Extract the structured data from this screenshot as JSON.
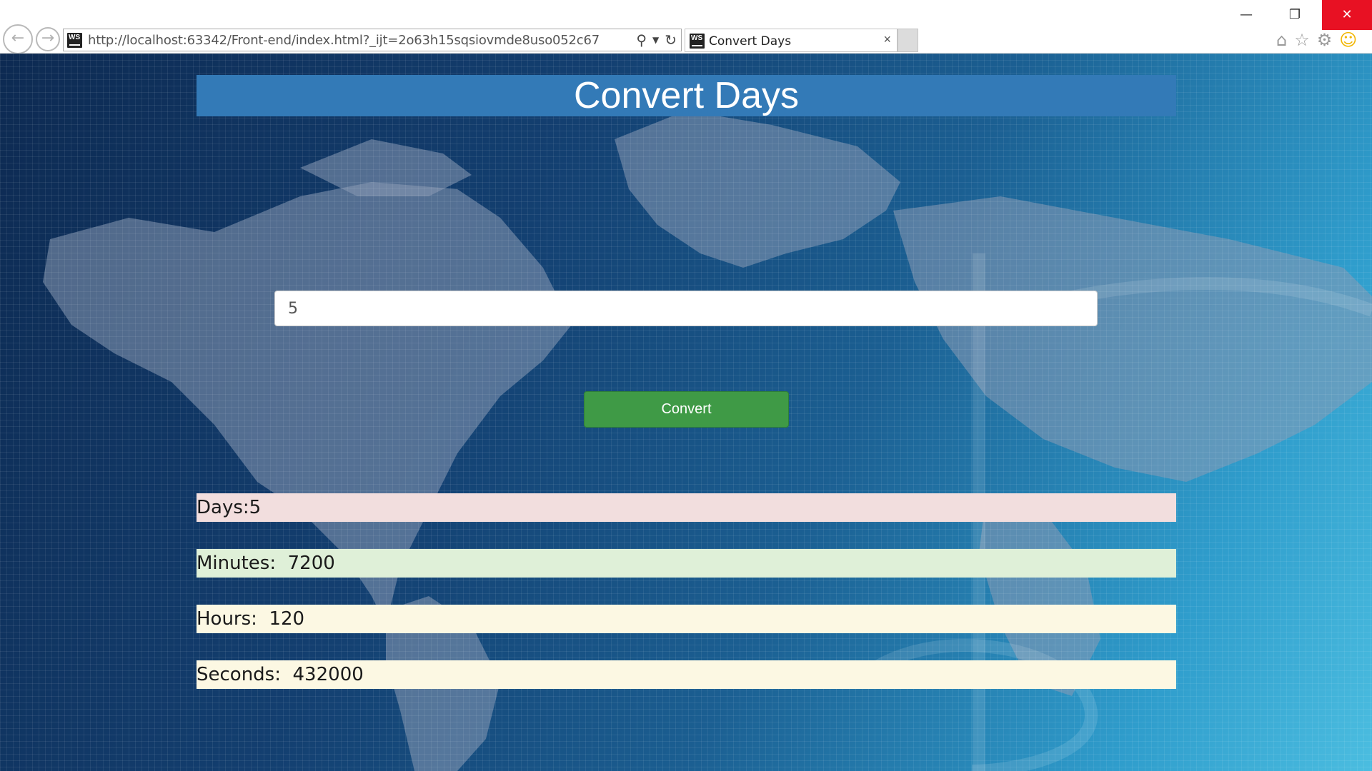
{
  "browser": {
    "url": "http://localhost:63342/Front-end/index.html?_ijt=2o63h15sqsiovmde8uso052c67",
    "tab_title": "Convert Days",
    "favicon_text": "WS",
    "icons": [
      "back-icon",
      "forward-icon",
      "search-icon",
      "dropdown-icon",
      "refresh-icon",
      "home-icon",
      "favorites-star-icon",
      "settings-gear-icon",
      "feedback-smiley-icon",
      "minimize-icon",
      "restore-icon",
      "close-icon"
    ]
  },
  "page": {
    "title": "Convert Days",
    "input_value": "5",
    "button_label": "Convert",
    "results": {
      "days": "Days:5",
      "minutes": "Minutes:  7200",
      "hours": "Hours:  120",
      "seconds": "Seconds:  432000"
    }
  },
  "colors": {
    "header_bg": "#337ab7",
    "button_bg": "#3f9a46",
    "days_bg": "#f2dede",
    "minutes_bg": "#dff0d8",
    "hours_bg": "#fcf8e3",
    "seconds_bg": "#fcf8e3"
  }
}
